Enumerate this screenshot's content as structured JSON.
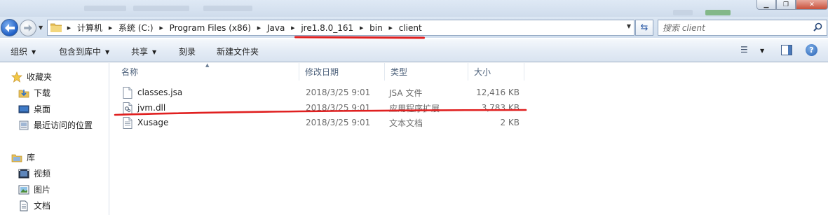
{
  "address": {
    "breadcrumbs": [
      "计算机",
      "系统 (C:)",
      "Program Files (x86)",
      "Java",
      "jre1.8.0_161",
      "bin",
      "client"
    ]
  },
  "search": {
    "placeholder": "搜索 client"
  },
  "toolbar": {
    "organize": "组织",
    "include_in_library": "包含到库中",
    "share": "共享",
    "burn": "刻录",
    "new_folder": "新建文件夹"
  },
  "nav": {
    "favorites_label": "收藏夹",
    "favorites": [
      "下载",
      "桌面",
      "最近访问的位置"
    ],
    "libraries_label": "库",
    "libraries": [
      "视频",
      "图片",
      "文档"
    ]
  },
  "columns": {
    "name": "名称",
    "modified": "修改日期",
    "type": "类型",
    "size": "大小"
  },
  "files": [
    {
      "name": "classes.jsa",
      "modified": "2018/3/25 9:01",
      "type": "JSA 文件",
      "size": "12,416 KB",
      "icon": "blank-file-icon"
    },
    {
      "name": "jvm.dll",
      "modified": "2018/3/25 9:01",
      "type": "应用程序扩展",
      "size": "3,783 KB",
      "icon": "dll-file-icon"
    },
    {
      "name": "Xusage",
      "modified": "2018/3/25 9:01",
      "type": "文本文档",
      "size": "2 KB",
      "icon": "text-file-icon"
    }
  ],
  "colors": {
    "annotation": "#e02020",
    "accent": "#1f5fc6"
  }
}
